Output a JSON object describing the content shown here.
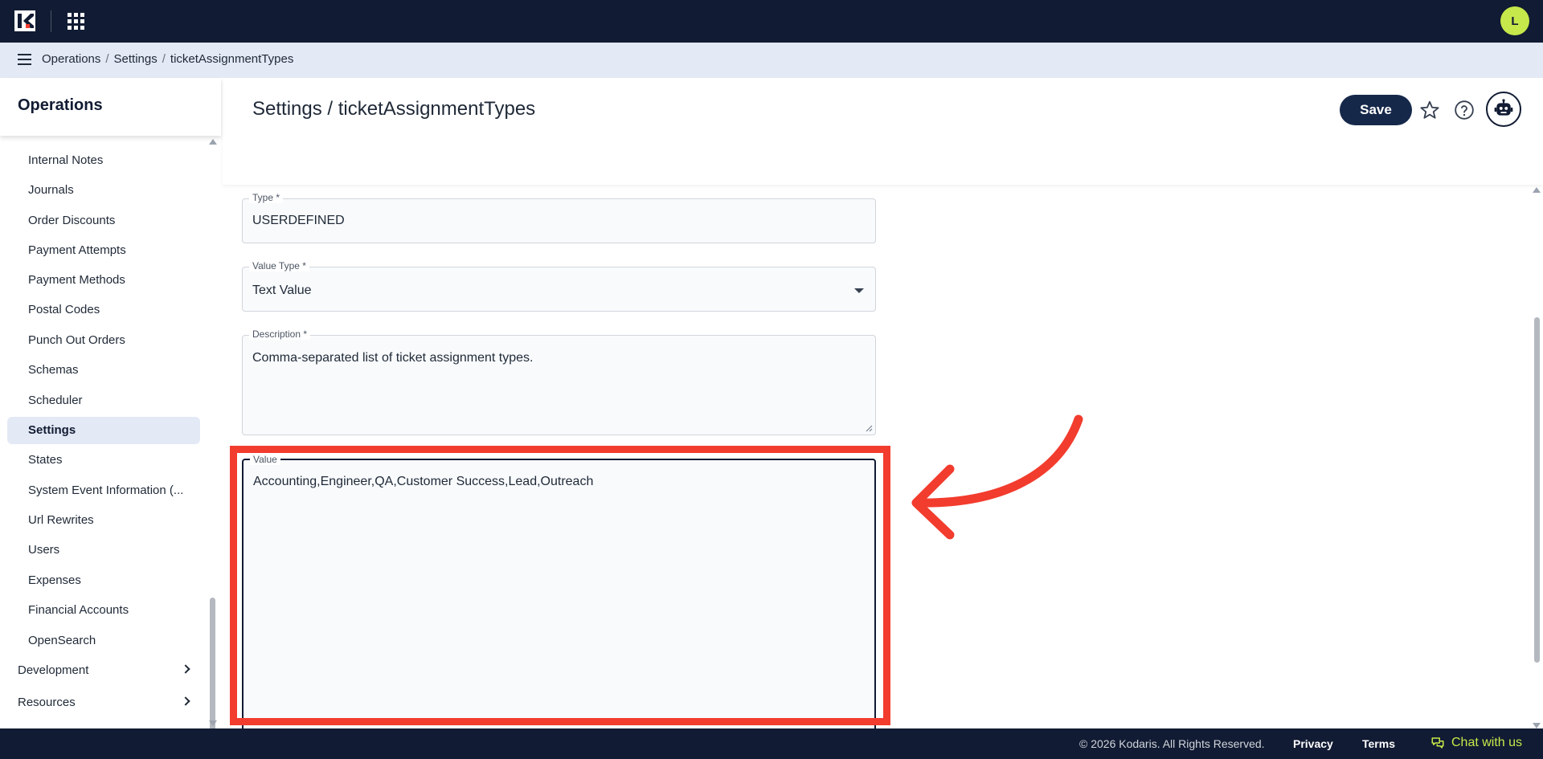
{
  "topbar": {
    "avatar_initial": "L"
  },
  "breadcrumb": [
    "Operations",
    "Settings",
    "ticketAssignmentTypes"
  ],
  "sidebar": {
    "title": "Operations",
    "items": [
      {
        "label": "Internal Notes",
        "active": false
      },
      {
        "label": "Journals",
        "active": false
      },
      {
        "label": "Order Discounts",
        "active": false
      },
      {
        "label": "Payment Attempts",
        "active": false
      },
      {
        "label": "Payment Methods",
        "active": false
      },
      {
        "label": "Postal Codes",
        "active": false
      },
      {
        "label": "Punch Out Orders",
        "active": false
      },
      {
        "label": "Schemas",
        "active": false
      },
      {
        "label": "Scheduler",
        "active": false
      },
      {
        "label": "Settings",
        "active": true
      },
      {
        "label": "States",
        "active": false
      },
      {
        "label": "System Event Information (...",
        "active": false
      },
      {
        "label": "Url Rewrites",
        "active": false
      },
      {
        "label": "Users",
        "active": false
      },
      {
        "label": "Expenses",
        "active": false
      },
      {
        "label": "Financial Accounts",
        "active": false
      },
      {
        "label": "OpenSearch",
        "active": false
      }
    ],
    "groups": [
      {
        "label": "Development"
      },
      {
        "label": "Resources"
      }
    ]
  },
  "header": {
    "title": "Settings / ticketAssignmentTypes",
    "save_label": "Save"
  },
  "form": {
    "type": {
      "label": "Type *",
      "value": "USERDEFINED"
    },
    "value_type": {
      "label": "Value Type *",
      "value": "Text Value"
    },
    "description": {
      "label": "Description *",
      "value": "Comma-separated list of ticket assignment types."
    },
    "value": {
      "label": "Value",
      "value": "Accounting,Engineer,QA,Customer Success,Lead,Outreach"
    }
  },
  "footer": {
    "copyright": "© 2026 Kodaris. All Rights Reserved.",
    "privacy": "Privacy",
    "terms": "Terms",
    "chat": "Chat with us"
  },
  "colors": {
    "navy": "#111b33",
    "accent_lime": "#c6e84a",
    "annotation_red": "#f23c2e",
    "active_bg": "#e3e9f5"
  }
}
